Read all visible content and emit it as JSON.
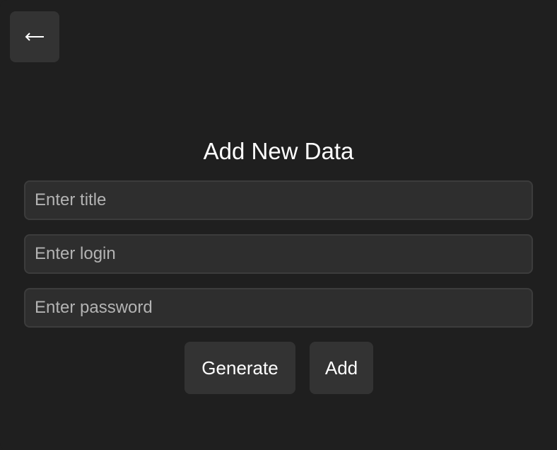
{
  "nav": {
    "back_icon": "back-arrow-icon"
  },
  "form": {
    "title": "Add New Data",
    "fields": {
      "title_placeholder": "Enter title",
      "login_placeholder": "Enter login",
      "password_placeholder": "Enter password"
    },
    "buttons": {
      "generate_label": "Generate",
      "add_label": "Add"
    }
  },
  "colors": {
    "background": "#1f1f1f",
    "surface": "#333333",
    "input_background": "#2e2e2e",
    "text": "#ffffff"
  }
}
